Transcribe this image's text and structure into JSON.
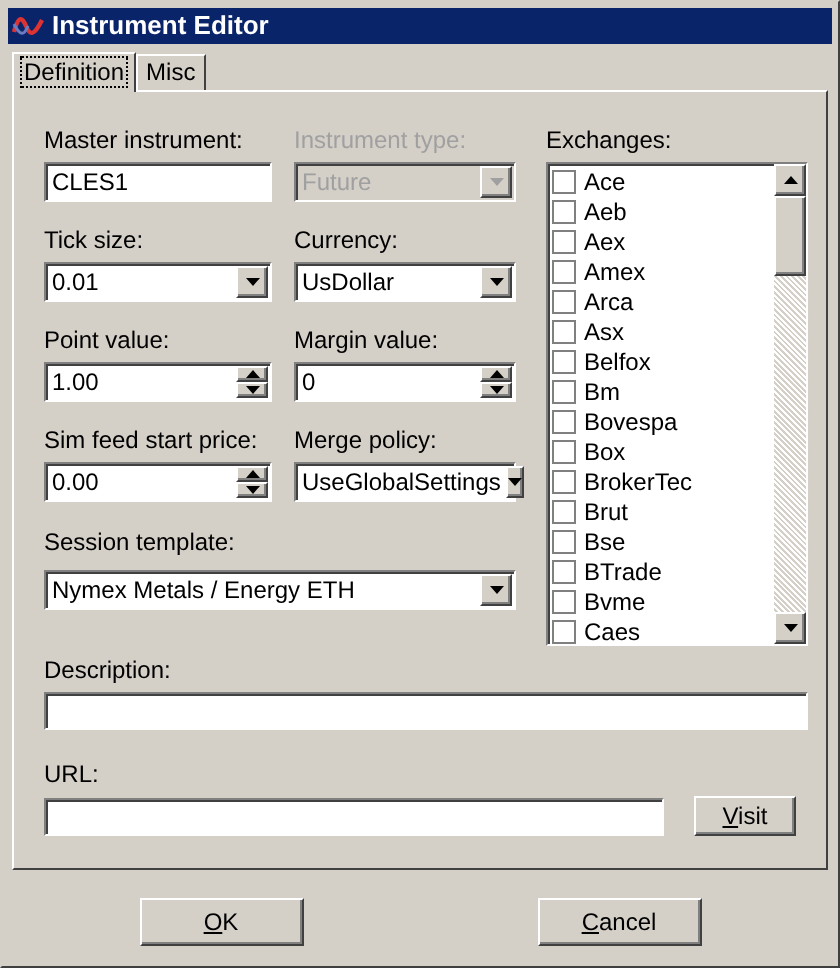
{
  "window": {
    "title": "Instrument Editor"
  },
  "tabs": [
    {
      "label": "Definition",
      "selected": true
    },
    {
      "label": "Misc",
      "selected": false
    }
  ],
  "fields": [
    {
      "kind": "text",
      "label": "Master instrument:",
      "value": "CLES1",
      "disabled": false
    },
    {
      "kind": "dropdown",
      "label": "Instrument type:",
      "value": "Future",
      "disabled": true
    },
    {
      "kind": "dropdown",
      "label": "Tick size:",
      "value": "0.01",
      "disabled": false
    },
    {
      "kind": "dropdown",
      "label": "Currency:",
      "value": "UsDollar",
      "disabled": false
    },
    {
      "kind": "spinner",
      "label": "Point value:",
      "value": "1.00",
      "disabled": false
    },
    {
      "kind": "spinner",
      "label": "Margin value:",
      "value": "0",
      "disabled": false
    },
    {
      "kind": "spinner",
      "label": "Sim feed start price:",
      "value": "0.00",
      "disabled": false
    },
    {
      "kind": "dropdown",
      "label": "Merge policy:",
      "value": "UseGlobalSettings",
      "disabled": false
    }
  ],
  "session_template": {
    "label": "Session template:",
    "value": "Nymex Metals / Energy ETH"
  },
  "exchanges": {
    "label": "Exchanges:",
    "items": [
      {
        "label": "Ace",
        "checked": false
      },
      {
        "label": "Aeb",
        "checked": false
      },
      {
        "label": "Aex",
        "checked": false
      },
      {
        "label": "Amex",
        "checked": false
      },
      {
        "label": "Arca",
        "checked": false
      },
      {
        "label": "Asx",
        "checked": false
      },
      {
        "label": "Belfox",
        "checked": false
      },
      {
        "label": "Bm",
        "checked": false
      },
      {
        "label": "Bovespa",
        "checked": false
      },
      {
        "label": "Box",
        "checked": false
      },
      {
        "label": "BrokerTec",
        "checked": false
      },
      {
        "label": "Brut",
        "checked": false
      },
      {
        "label": "Bse",
        "checked": false
      },
      {
        "label": "BTrade",
        "checked": false
      },
      {
        "label": "Bvme",
        "checked": false
      },
      {
        "label": "Caes",
        "checked": false
      }
    ]
  },
  "description": {
    "label": "Description:"
  },
  "url": {
    "label": "URL:"
  },
  "visit_button": {
    "accel": "V",
    "rest": "isit"
  },
  "buttons": [
    {
      "accel": "O",
      "rest": "K"
    },
    {
      "accel": "C",
      "rest": "ancel"
    }
  ]
}
